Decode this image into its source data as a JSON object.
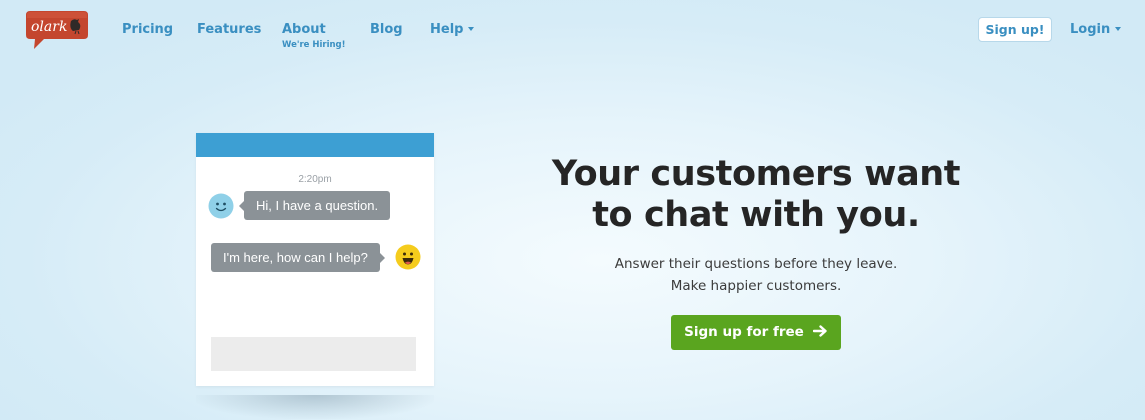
{
  "brand": {
    "logo_text": "olark",
    "logo_color": "#c4462e"
  },
  "nav": {
    "items": [
      {
        "label": "Pricing"
      },
      {
        "label": "Features"
      },
      {
        "label": "About",
        "sublabel": "We're Hiring!"
      },
      {
        "label": "Blog"
      },
      {
        "label": "Help",
        "dropdown": true
      }
    ],
    "signup_label": "Sign up!",
    "login_label": "Login",
    "link_color": "#3a8fc1"
  },
  "chat_widget": {
    "timestamp": "2:20pm",
    "messages": [
      {
        "from": "visitor",
        "text": "Hi, I have a question.",
        "avatar_icon": "smiley-blue-icon"
      },
      {
        "from": "operator",
        "text": "I'm here, how can I help?",
        "avatar_icon": "smiley-yellow-icon"
      }
    ],
    "header_color": "#3d9fd3",
    "bubble_color": "#8b9297"
  },
  "hero": {
    "title_line1": "Your customers want",
    "title_line2": "to chat with you.",
    "subtitle_line1": "Answer their questions before they leave.",
    "subtitle_line2": "Make happier customers.",
    "cta_label": "Sign up for free",
    "cta_icon": "arrow-right-icon",
    "cta_color": "#5aa51f"
  }
}
